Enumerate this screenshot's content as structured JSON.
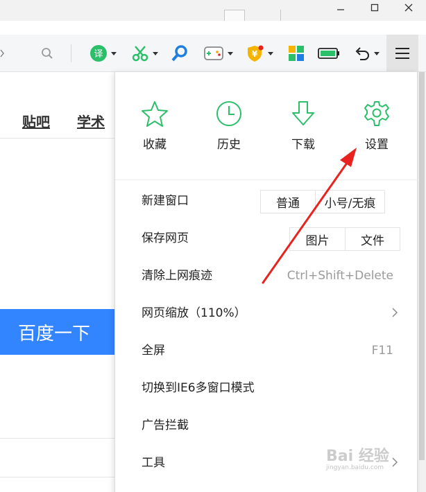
{
  "page": {
    "nav_links": [
      "贴吧",
      "学术"
    ],
    "search_button": "百度一下"
  },
  "menu": {
    "quick_items": [
      {
        "label": "收藏",
        "icon": "star-icon"
      },
      {
        "label": "历史",
        "icon": "clock-icon"
      },
      {
        "label": "下载",
        "icon": "download-icon"
      },
      {
        "label": "设置",
        "icon": "gear-icon"
      }
    ],
    "rows": {
      "new_window": {
        "label": "新建窗口",
        "buttons": [
          "普通",
          "小号/无痕"
        ]
      },
      "save_page": {
        "label": "保存网页",
        "buttons": [
          "图片",
          "文件"
        ]
      },
      "clear_traces": {
        "label": "清除上网痕迹",
        "shortcut": "Ctrl+Shift+Delete"
      },
      "zoom": {
        "label": "网页缩放（110%）"
      },
      "fullscreen": {
        "label": "全屏",
        "shortcut": "F11"
      },
      "ie6_mode": {
        "label": "切换到IE6多窗口模式"
      },
      "adblock": {
        "label": "广告拦截"
      },
      "tools": {
        "label": "工具"
      }
    }
  },
  "colors": {
    "accent_green": "#2bbf6a",
    "search_blue": "#3385ff",
    "annotation_red": "#e8231f"
  },
  "watermark": {
    "text": "Bai 经验",
    "sub": "jingyan.baidu.com"
  }
}
